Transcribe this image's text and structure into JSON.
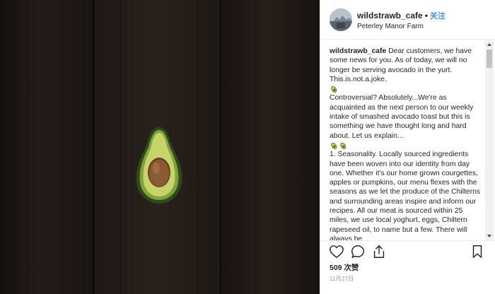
{
  "post": {
    "username": "wildstrawb_cafe",
    "separator": "•",
    "follow_label": "关注",
    "location": "Peterley Manor Farm"
  },
  "caption": {
    "author": "wildstrawb_cafe",
    "lines": [
      "Dear customers, we have some news for you. As of today, we will no longer be serving avocado in the yurt. This.is.not.a.joke.",
      "Controversial? Absolutely...We're as acquainted as the next person to our weekly intake of smashed avocado toast but this is something we have thought long and hard about. Let us explain...",
      "1. Seasonality. Locally sourced ingredients have been woven into our identity from day one. Whether it's our home grown courgettes, apples or pumpkins, our menu flexes with the seasons as we let the produce of the Chilterns and surrounding areas inspire and inform our recipes. All our meat is sourced within 25 miles, we use local yoghurt, eggs, Chiltern rapeseed oil, to name but a few. There will always be"
    ],
    "emoji": "avocado-emoji"
  },
  "engagement": {
    "likes": "509 次赞",
    "date": "11月27日"
  },
  "icons": {
    "like": "heart-icon",
    "comment": "comment-icon",
    "share": "share-icon",
    "save": "bookmark-icon"
  },
  "colors": {
    "link": "#3897f0",
    "text": "#262626",
    "muted": "#999999",
    "avocado_skin": "#2e4a1a",
    "avocado_flesh": "#b9c85a",
    "pit": "#8a5a34"
  }
}
